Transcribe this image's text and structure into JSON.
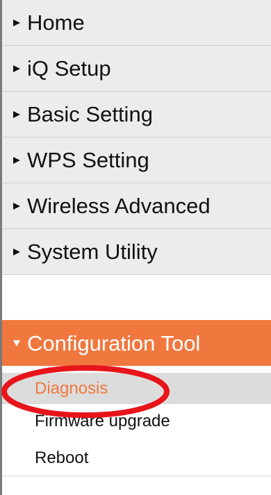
{
  "menu": {
    "items": [
      {
        "label": "Home"
      },
      {
        "label": "iQ Setup"
      },
      {
        "label": "Basic Setting"
      },
      {
        "label": "WPS Setting"
      },
      {
        "label": "Wireless Advanced"
      },
      {
        "label": "System Utility"
      },
      {
        "label": "Configuration Tool"
      }
    ],
    "active_index": 6,
    "submenu": [
      {
        "label": "Diagnosis"
      },
      {
        "label": "Firmware upgrade"
      },
      {
        "label": "Reboot"
      }
    ],
    "selected_submenu_index": 0
  },
  "icons": {
    "collapsed_arrow": "triangle-right-icon",
    "expanded_arrow": "triangle-down-icon"
  },
  "colors": {
    "active_background": "#f0783f",
    "item_background": "#ececec",
    "selected_sub_text": "#f0783f",
    "annotation_circle": "#e8141b"
  }
}
